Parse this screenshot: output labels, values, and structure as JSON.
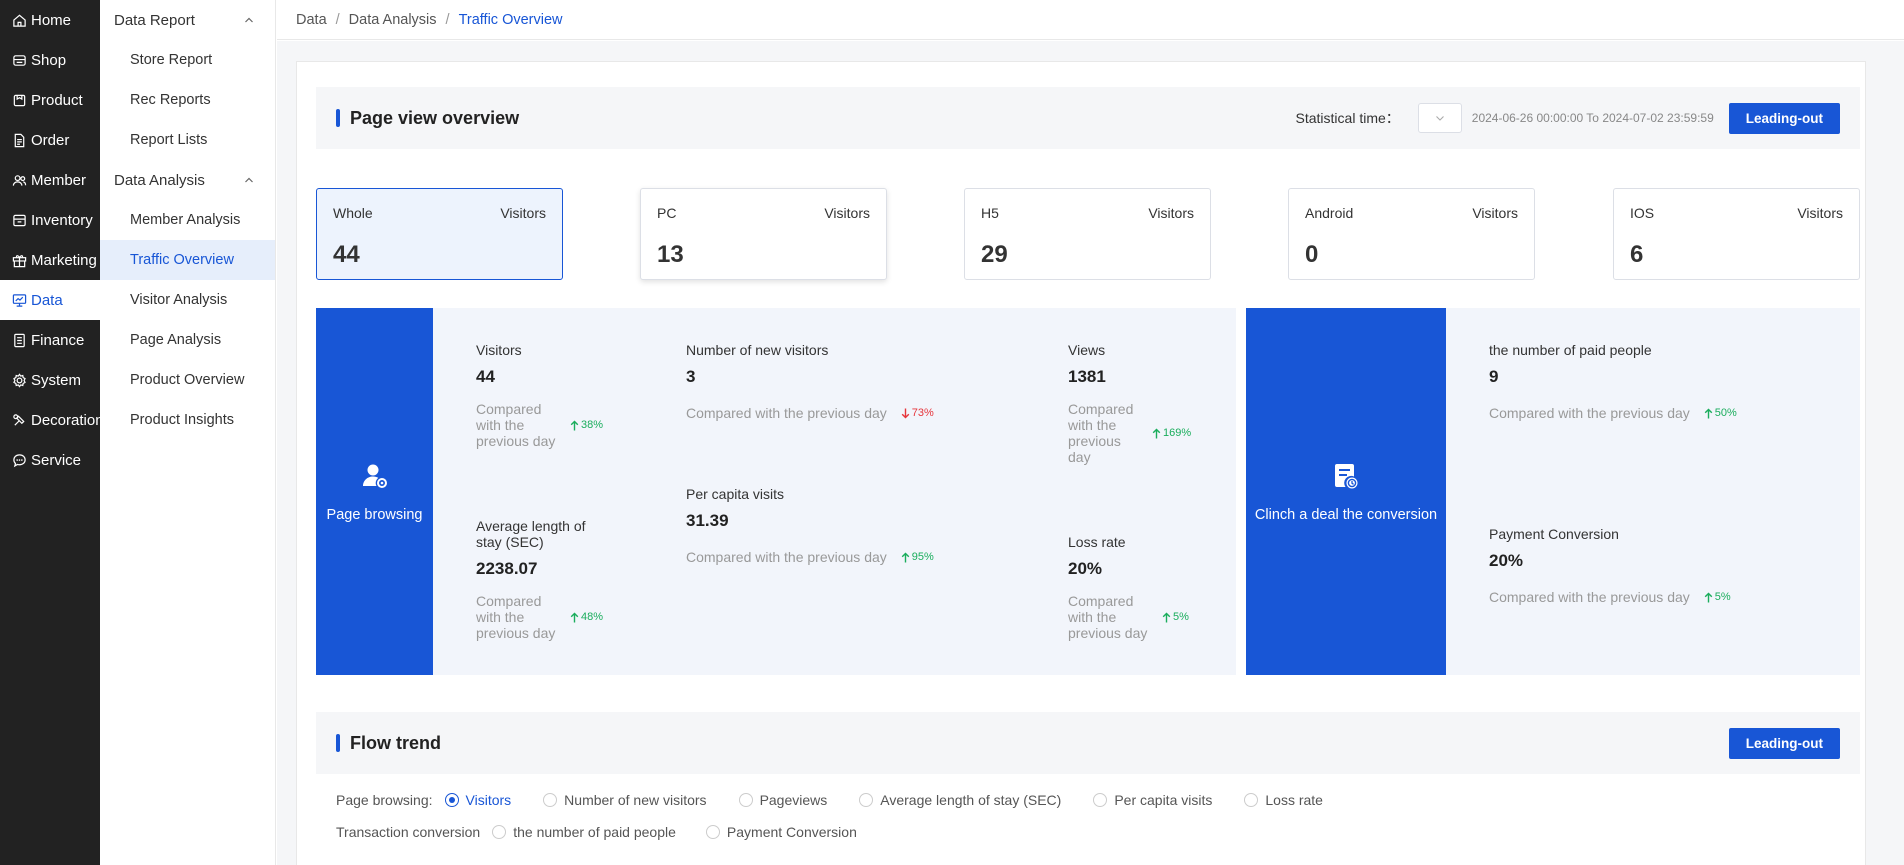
{
  "nav": [
    {
      "label": "Home",
      "icon": "home-icon"
    },
    {
      "label": "Shop",
      "icon": "shop-icon"
    },
    {
      "label": "Product",
      "icon": "product-icon"
    },
    {
      "label": "Order",
      "icon": "order-icon"
    },
    {
      "label": "Member",
      "icon": "member-icon"
    },
    {
      "label": "Inventory",
      "icon": "inventory-icon"
    },
    {
      "label": "Marketing",
      "icon": "marketing-icon"
    },
    {
      "label": "Data",
      "icon": "data-icon",
      "active": true
    },
    {
      "label": "Finance",
      "icon": "finance-icon"
    },
    {
      "label": "System",
      "icon": "system-icon"
    },
    {
      "label": "Decoration",
      "icon": "decoration-icon"
    },
    {
      "label": "Service",
      "icon": "service-icon"
    }
  ],
  "subnav": {
    "groups": [
      {
        "label": "Data Report",
        "items": [
          "Store Report",
          "Rec Reports",
          "Report Lists"
        ]
      },
      {
        "label": "Data Analysis",
        "items": [
          "Member Analysis",
          "Traffic Overview",
          "Visitor Analysis",
          "Page Analysis",
          "Product Overview",
          "Product Insights"
        ]
      }
    ],
    "active": "Traffic Overview"
  },
  "breadcrumb": [
    "Data",
    "Data Analysis",
    "Traffic Overview"
  ],
  "breadcrumb_sep": "/",
  "overview": {
    "title": "Page view overview",
    "stat_label": "Statistical time：",
    "date_range": "2024-06-26 00:00:00 To 2024-07-02 23:59:59",
    "export_label": "Leading-out"
  },
  "cards": [
    {
      "name": "Whole",
      "metric": "Visitors",
      "value": "44"
    },
    {
      "name": "PC",
      "metric": "Visitors",
      "value": "13"
    },
    {
      "name": "H5",
      "metric": "Visitors",
      "value": "29"
    },
    {
      "name": "Android",
      "metric": "Visitors",
      "value": "0"
    },
    {
      "name": "IOS",
      "metric": "Visitors",
      "value": "6"
    }
  ],
  "page_browsing": {
    "title": "Page browsing",
    "visitors": {
      "label": "Visitors",
      "value": "44",
      "compare": "Compared with the previous day",
      "trend": "38%"
    },
    "new_visitors": {
      "label": "Number of new visitors",
      "value": "3",
      "compare": "Compared with the previous day",
      "trend": "73%"
    },
    "views": {
      "label": "Views",
      "value": "1381",
      "compare": "Compared with the previous day",
      "trend": "169%"
    },
    "avg_stay": {
      "label": "Average length of stay (SEC)",
      "value": "2238.07",
      "compare": "Compared with the previous day",
      "trend": "48%"
    },
    "per_capita": {
      "label": "Per capita visits",
      "value": "31.39",
      "compare": "Compared with the previous day",
      "trend": "95%"
    },
    "loss_rate": {
      "label": "Loss rate",
      "value": "20%",
      "compare": "Compared with the previous day",
      "trend": "5%"
    }
  },
  "conversion": {
    "title": "Clinch a deal the conversion",
    "paid": {
      "label": "the number of paid people",
      "value": "9",
      "compare": "Compared with the previous day",
      "trend": "50%"
    },
    "payment": {
      "label": "Payment Conversion",
      "value": "20%",
      "compare": "Compared with the previous day",
      "trend": "5%"
    }
  },
  "flow": {
    "title": "Flow trend",
    "export_label": "Leading-out",
    "browsing_label": "Page browsing:",
    "browsing_options": [
      "Visitors",
      "Number of new visitors",
      "Pageviews",
      "Average length of stay (SEC)",
      "Per capita visits",
      "Loss rate"
    ],
    "transaction_label": "Transaction conversion",
    "transaction_options": [
      "the number of paid people",
      "Payment Conversion"
    ],
    "selected": "Visitors"
  },
  "colors": {
    "primary": "#1856d6",
    "up": "#1aad5c",
    "down": "#e6353b",
    "nav_bg": "#222222"
  }
}
